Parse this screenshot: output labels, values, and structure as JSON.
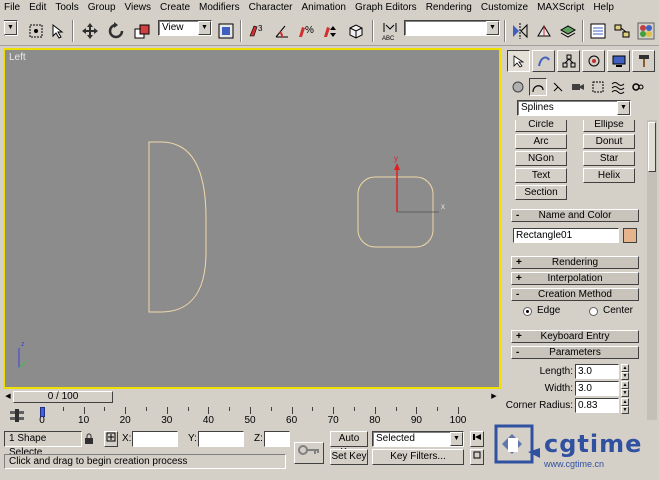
{
  "menu": [
    "File",
    "Edit",
    "Tools",
    "Group",
    "Views",
    "Create",
    "Modifiers",
    "Character",
    "Animation",
    "Graph Editors",
    "Rendering",
    "Customize",
    "MAXScript",
    "Help"
  ],
  "toolbar": {
    "view_combo": "View",
    "named_selection": "",
    "abc_label": "ABC"
  },
  "viewport": {
    "label": "Left",
    "axis_x": "x",
    "axis_y": "y",
    "axis_z": "z"
  },
  "command_panel": {
    "category_dropdown": "Splines",
    "object_buttons": [
      "Circle",
      "Ellipse",
      "Arc",
      "Donut",
      "NGon",
      "Star",
      "Text",
      "Helix",
      "Section"
    ],
    "name_color": {
      "title": "Name and Color",
      "name_value": "Rectangle01",
      "color": "#e6b48c"
    },
    "rollouts": {
      "rendering": "Rendering",
      "interpolation": "Interpolation",
      "creation_method": "Creation Method",
      "keyboard_entry": "Keyboard Entry",
      "parameters": "Parameters"
    },
    "creation_method": {
      "edge_label": "Edge",
      "center_label": "Center",
      "selected": "Edge"
    },
    "parameters": {
      "length_label": "Length:",
      "length_value": "3.0",
      "width_label": "Width:",
      "width_value": "3.0",
      "corner_label": "Corner Radius:",
      "corner_value": "0.83"
    },
    "rollout_signs": {
      "expanded": "-",
      "collapsed": "+"
    }
  },
  "timeline": {
    "frame_display": "0 / 100",
    "ticks": [
      "0",
      "10",
      "20",
      "30",
      "40",
      "50",
      "60",
      "70",
      "80",
      "90",
      "100"
    ]
  },
  "status": {
    "selection": "1 Shape Selecte",
    "x_label": "X:",
    "y_label": "Y:",
    "z_label": "Z:",
    "auto_key": "Auto Key",
    "set_key": "Set Key",
    "key_mode": "Selected",
    "key_filters": "Key Filters...",
    "prompt": "Click and drag to begin creation process"
  },
  "watermark": {
    "brand": "cgtime",
    "url": "www.cgtime.cn"
  },
  "colors": {
    "viewport_bg": "#8c8c8c",
    "active_border": "#f0e000",
    "shape_stroke": "#f2d9a8",
    "ui_face": "#d4d0c8"
  }
}
